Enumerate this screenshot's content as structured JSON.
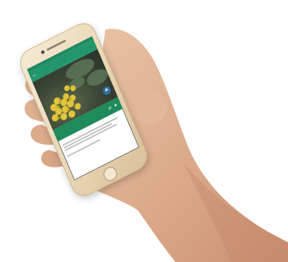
{
  "app": {
    "screen_title": "",
    "colors": {
      "status_bar": "#1f8a62",
      "app_bar": "#23976b",
      "title_banner": "#1f8a5c",
      "fab": "#2f6f9a",
      "flower": "#e2c43a"
    }
  },
  "plant": {
    "common_name": "",
    "latin_name": ""
  },
  "sections": [
    {
      "heading": "",
      "lines": [
        "",
        ""
      ]
    },
    {
      "heading": "",
      "lines": [
        ""
      ]
    }
  ],
  "icons": {
    "back": "arrow-left-icon",
    "fab": "leaf-icon",
    "share": "share-icon",
    "favorite": "star-icon"
  }
}
